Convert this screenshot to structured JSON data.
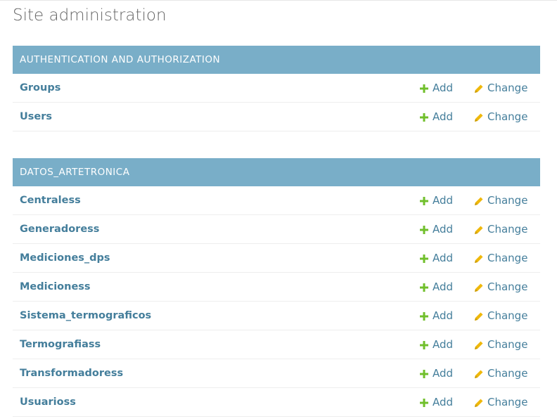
{
  "page": {
    "title": "Site administration"
  },
  "colors": {
    "header_bg": "#79aec8",
    "link": "#447e9b",
    "add_icon": "#70bf2b",
    "change_icon": "#efb80b"
  },
  "icons": {
    "add": "plus-icon",
    "change": "pencil-icon"
  },
  "modules": [
    {
      "caption": "AUTHENTICATION AND AUTHORIZATION",
      "models": [
        {
          "name": "Groups",
          "add_label": "Add",
          "change_label": "Change"
        },
        {
          "name": "Users",
          "add_label": "Add",
          "change_label": "Change"
        }
      ]
    },
    {
      "caption": "DATOS_ARTETRONICA",
      "models": [
        {
          "name": "Centraless",
          "add_label": "Add",
          "change_label": "Change"
        },
        {
          "name": "Generadoress",
          "add_label": "Add",
          "change_label": "Change"
        },
        {
          "name": "Mediciones_dps",
          "add_label": "Add",
          "change_label": "Change"
        },
        {
          "name": "Medicioness",
          "add_label": "Add",
          "change_label": "Change"
        },
        {
          "name": "Sistema_termograficos",
          "add_label": "Add",
          "change_label": "Change"
        },
        {
          "name": "Termografiass",
          "add_label": "Add",
          "change_label": "Change"
        },
        {
          "name": "Transformadoress",
          "add_label": "Add",
          "change_label": "Change"
        },
        {
          "name": "Usuarioss",
          "add_label": "Add",
          "change_label": "Change"
        }
      ]
    }
  ]
}
